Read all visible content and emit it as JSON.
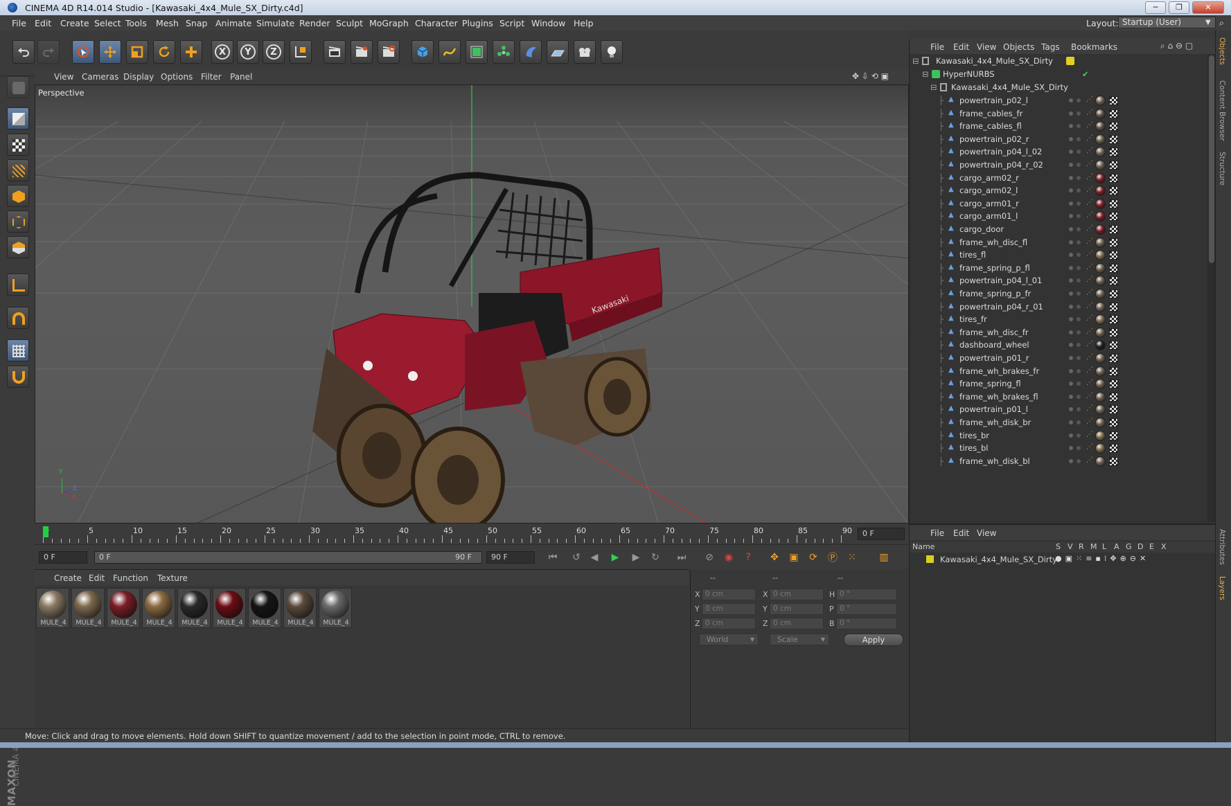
{
  "window": {
    "title": "CINEMA 4D R14.014 Studio - [Kawasaki_4x4_Mule_SX_Dirty.c4d]",
    "controls": [
      "─",
      "❐",
      "✕"
    ]
  },
  "menubar": {
    "items": [
      "File",
      "Edit",
      "Create",
      "Select",
      "Tools",
      "Mesh",
      "Snap",
      "Animate",
      "Simulate",
      "Render",
      "Sculpt",
      "MoGraph",
      "Character",
      "Plugins",
      "Script",
      "Window",
      "Help"
    ],
    "layout_label": "Layout:",
    "layout_value": "Startup (User)"
  },
  "toolbar": {
    "icons": [
      "undo-icon",
      "redo-icon",
      "live-selection-icon",
      "move-icon",
      "scale-icon",
      "rotate-icon",
      "add-icon",
      "x-axis-icon",
      "y-axis-icon",
      "z-axis-icon",
      "coordinate-system-icon",
      "render-view-icon",
      "render-picture-viewer-icon",
      "edit-render-settings-icon",
      "cube-icon",
      "spline-icon",
      "nurbs-icon",
      "array-icon",
      "deformer-icon",
      "floor-icon",
      "camera-icon",
      "light-icon"
    ],
    "axis_labels": [
      "X",
      "Y",
      "Z"
    ]
  },
  "viewport": {
    "menu": [
      "View",
      "Cameras",
      "Display",
      "Options",
      "Filter",
      "Panel"
    ],
    "label": "Perspective",
    "axis_y": "Y",
    "axis_z": "Z",
    "axis_x": "X",
    "vehicle_brand": "Kawasaki"
  },
  "timeline": {
    "ticks": [
      "0",
      "5",
      "10",
      "15",
      "20",
      "25",
      "30",
      "35",
      "40",
      "45",
      "50",
      "55",
      "60",
      "65",
      "70",
      "75",
      "80",
      "85",
      "90"
    ],
    "current_frame": "0 F",
    "start_field": "0 F",
    "range_start": "0 F",
    "range_end": "90 F",
    "end_field": "90 F"
  },
  "materials": {
    "menu": [
      "Create",
      "Edit",
      "Function",
      "Texture"
    ],
    "items": [
      {
        "label": "MULE_4",
        "color": "#8a7a62"
      },
      {
        "label": "MULE_4",
        "color": "#7d6a4e"
      },
      {
        "label": "MULE_4",
        "color": "#7a1e26"
      },
      {
        "label": "MULE_4",
        "color": "#8b6a40"
      },
      {
        "label": "MULE_4",
        "color": "#2a2a2a"
      },
      {
        "label": "MULE_4",
        "color": "#6a0e14"
      },
      {
        "label": "MULE_4",
        "color": "#151515"
      },
      {
        "label": "MULE_4",
        "color": "#5a4a3c"
      },
      {
        "label": "MULE_4",
        "color": "#6a6a6a"
      }
    ]
  },
  "coords": {
    "header": [
      "--",
      "--",
      "--"
    ],
    "rows": [
      {
        "pos_label": "X",
        "pos": "0 cm",
        "size_label": "X",
        "size": "0 cm",
        "rot_label": "H",
        "rot": "0 °"
      },
      {
        "pos_label": "Y",
        "pos": "0 cm",
        "size_label": "Y",
        "size": "0 cm",
        "rot_label": "P",
        "rot": "0 °"
      },
      {
        "pos_label": "Z",
        "pos": "0 cm",
        "size_label": "Z",
        "size": "0 cm",
        "rot_label": "B",
        "rot": "0 °"
      }
    ],
    "mode1": "World",
    "mode2": "Scale",
    "apply": "Apply"
  },
  "objects": {
    "menu": [
      "File",
      "Edit",
      "View",
      "Objects",
      "Tags",
      "Bookmarks"
    ],
    "root": "Kawasaki_4x4_Mule_SX_Dirty",
    "hypernurbs": "HyperNURBS",
    "group": "Kawasaki_4x4_Mule_SX_Dirty",
    "items": [
      {
        "name": "powertrain_p02_l",
        "mat": "#6b5e4e"
      },
      {
        "name": "frame_cables_fr",
        "mat": "#5e5244"
      },
      {
        "name": "frame_cables_fl",
        "mat": "#5e5244"
      },
      {
        "name": "powertrain_p02_r",
        "mat": "#6b5e4e"
      },
      {
        "name": "powertrain_p04_l_02",
        "mat": "#6b5e4e"
      },
      {
        "name": "powertrain_p04_r_02",
        "mat": "#6b5e4e"
      },
      {
        "name": "cargo_arm02_r",
        "mat": "#7a1e26"
      },
      {
        "name": "cargo_arm02_l",
        "mat": "#7a1e26"
      },
      {
        "name": "cargo_arm01_r",
        "mat": "#7a1e26"
      },
      {
        "name": "cargo_arm01_l",
        "mat": "#7a1e26"
      },
      {
        "name": "cargo_door",
        "mat": "#7a1e26"
      },
      {
        "name": "frame_wh_disc_fl",
        "mat": "#6b5e4e"
      },
      {
        "name": "tires_fl",
        "mat": "#7d6a4e"
      },
      {
        "name": "frame_spring_p_fl",
        "mat": "#6b5e4e"
      },
      {
        "name": "powertrain_p04_l_01",
        "mat": "#6b5e4e"
      },
      {
        "name": "frame_spring_p_fr",
        "mat": "#6b5e4e"
      },
      {
        "name": "powertrain_p04_r_01",
        "mat": "#6b5e4e"
      },
      {
        "name": "tires_fr",
        "mat": "#7d6a4e"
      },
      {
        "name": "frame_wh_disc_fr",
        "mat": "#6b5e4e"
      },
      {
        "name": "dashboard_wheel",
        "mat": "#1e1e1e"
      },
      {
        "name": "powertrain_p01_r",
        "mat": "#6b5e4e"
      },
      {
        "name": "frame_wh_brakes_fr",
        "mat": "#6b5e4e"
      },
      {
        "name": "frame_spring_fl",
        "mat": "#6b5e4e"
      },
      {
        "name": "frame_wh_brakes_fl",
        "mat": "#6b5e4e"
      },
      {
        "name": "powertrain_p01_l",
        "mat": "#6b5e4e"
      },
      {
        "name": "frame_wh_disk_br",
        "mat": "#6b5e4e"
      },
      {
        "name": "tires_br",
        "mat": "#7d6a4e"
      },
      {
        "name": "tires_bl",
        "mat": "#7d6a4e"
      },
      {
        "name": "frame_wh_disk_bl",
        "mat": "#6b5e4e"
      }
    ]
  },
  "layers": {
    "menu": [
      "File",
      "Edit",
      "View"
    ],
    "columns": [
      "Name",
      "S",
      "V",
      "R",
      "M",
      "L",
      "A",
      "G",
      "D",
      "E",
      "X"
    ],
    "row_name": "Kawasaki_4x4_Mule_SX_Dirty",
    "row_color": "#d8d020"
  },
  "side_tabs": [
    "Objects",
    "Content Browser",
    "Structure",
    "Attributes",
    "Layers"
  ],
  "status": "Move: Click and drag to move elements. Hold down SHIFT to quantize movement / add to the selection in point mode, CTRL to remove.",
  "brand": {
    "line1": "MAXON",
    "line2": "CINEMA 4D"
  }
}
